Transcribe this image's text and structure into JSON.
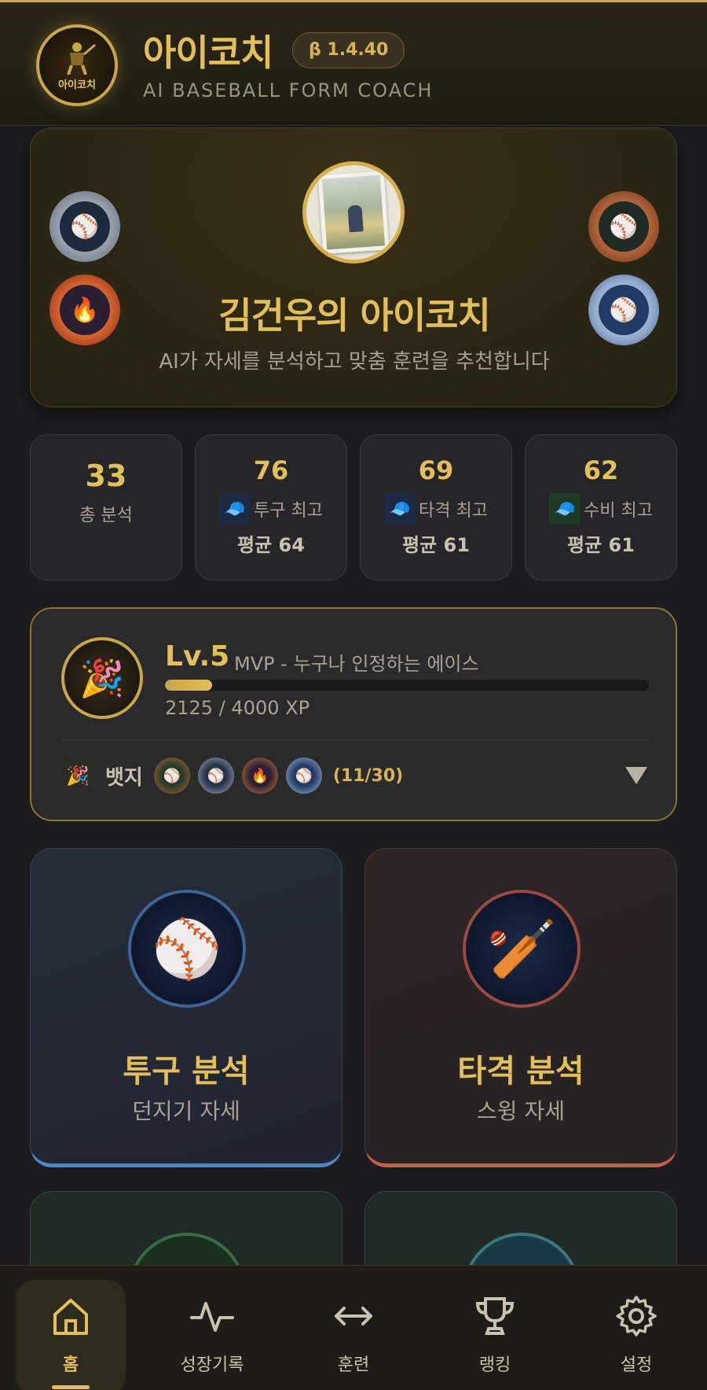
{
  "header": {
    "logo_text": "아이코치",
    "app_title": "아이코치",
    "version": "β 1.4.40",
    "subtitle": "AI BASEBALL FORM COACH"
  },
  "hero": {
    "name": "김건우의 아이코치",
    "description": "AI가 자세를 분석하고 맞춤 훈련을 추천합니다"
  },
  "stats": [
    {
      "value": "33",
      "label": "총 분석"
    },
    {
      "value": "76",
      "label": "투구 최고",
      "avg": "평균 64"
    },
    {
      "value": "69",
      "label": "타격 최고",
      "avg": "평균 61"
    },
    {
      "value": "62",
      "label": "수비 최고",
      "avg": "평균 61"
    }
  ],
  "level": {
    "level": "Lv.5",
    "title": "MVP - 누구나 인정하는 에이스",
    "xp_current": 2125,
    "xp_max": 4000,
    "xp_text": "2125 / 4000 XP",
    "badge_label": "뱃지",
    "badge_count": "(11/30)"
  },
  "analysis": [
    {
      "title": "투구 분석",
      "subtitle": "던지기 자세",
      "accent": "#4f86c4"
    },
    {
      "title": "타격 분석",
      "subtitle": "스윙 자세",
      "accent": "#c85a48"
    }
  ],
  "nav": [
    {
      "label": "홈",
      "icon": "home-icon",
      "active": true
    },
    {
      "label": "성장기록",
      "icon": "activity-icon"
    },
    {
      "label": "훈련",
      "icon": "arrows-icon"
    },
    {
      "label": "랭킹",
      "icon": "trophy-icon"
    },
    {
      "label": "설정",
      "icon": "gear-icon"
    }
  ],
  "colors": {
    "accent": "#e2bf5a",
    "background": "#1c1c1e",
    "card": "#262628"
  }
}
